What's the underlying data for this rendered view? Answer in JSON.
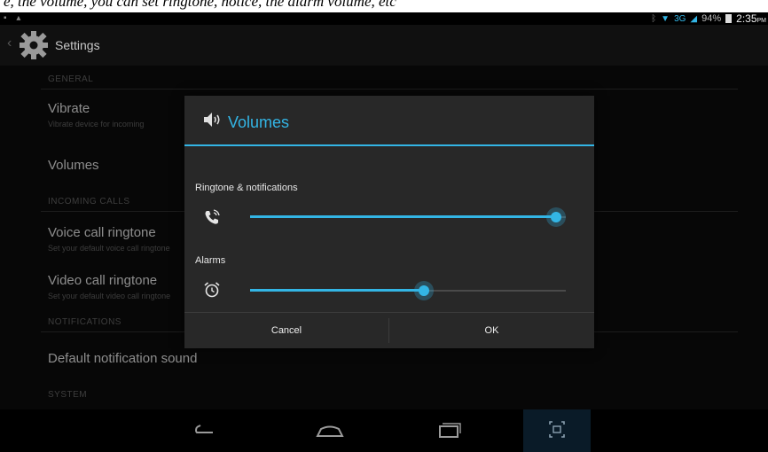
{
  "caption": {
    "text": "e, the volume, you can set ringtone, notice, the alarm volume, etc"
  },
  "status_bar": {
    "network": "3G",
    "battery": "94%",
    "time": "2:35",
    "ampm": "PM"
  },
  "action_bar": {
    "title": "Settings"
  },
  "settings": {
    "general_header": "GENERAL",
    "vibrate": {
      "title": "Vibrate",
      "subtitle": "Vibrate device for incoming"
    },
    "volumes": {
      "title": "Volumes"
    },
    "incoming_calls_header": "INCOMING CALLS",
    "voice_call_ringtone": {
      "title": "Voice call ringtone",
      "subtitle": "Set your default voice call ringtone"
    },
    "video_call_ringtone": {
      "title": "Video call ringtone",
      "subtitle": "Set your default video call ringtone"
    },
    "notifications_header": "NOTIFICATIONS",
    "default_notification_sound": {
      "title": "Default notification sound"
    },
    "system_header": "SYSTEM"
  },
  "dialog": {
    "title": "Volumes",
    "ringtone": {
      "label": "Ringtone & notifications",
      "level": 0.97
    },
    "alarms": {
      "label": "Alarms",
      "level": 0.55
    },
    "cancel_label": "Cancel",
    "ok_label": "OK"
  },
  "colors": {
    "accent": "#33b5e5",
    "dialog_bg": "#282828",
    "screen_bg": "#0c0c0c"
  },
  "icons": {
    "status_left": [
      "image-icon",
      "android-icon"
    ],
    "status_right": [
      "bluetooth-icon",
      "wifi-icon",
      "signal-icon",
      "battery-icon"
    ],
    "action_bar": "settings-gear-icon",
    "dialog_header": "speaker-icon",
    "ringtone": "phone-ringing-icon",
    "alarms": "alarm-clock-icon",
    "nav": [
      "back-icon",
      "home-icon",
      "recent-apps-icon",
      "screenshot-icon"
    ]
  }
}
